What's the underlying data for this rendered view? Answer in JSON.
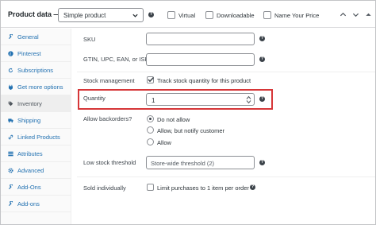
{
  "header": {
    "title": "Product data —",
    "product_type": "Simple product",
    "virtual_label": "Virtual",
    "downloadable_label": "Downloadable",
    "name_your_price_label": "Name Your Price"
  },
  "sidebar": {
    "items": [
      {
        "label": "General",
        "icon": "wrench-icon"
      },
      {
        "label": "Pinterest",
        "icon": "pinterest-icon"
      },
      {
        "label": "Subscriptions",
        "icon": "refresh-icon"
      },
      {
        "label": "Get more options",
        "icon": "plugin-icon"
      },
      {
        "label": "Inventory",
        "icon": "tag-icon",
        "active": true
      },
      {
        "label": "Shipping",
        "icon": "truck-icon"
      },
      {
        "label": "Linked Products",
        "icon": "link-icon"
      },
      {
        "label": "Attributes",
        "icon": "list-icon"
      },
      {
        "label": "Advanced",
        "icon": "gear-icon"
      },
      {
        "label": "Add-Ons",
        "icon": "wrench-icon"
      },
      {
        "label": "Add-ons",
        "icon": "wrench-icon"
      }
    ]
  },
  "inventory": {
    "sku_label": "SKU",
    "sku_value": "",
    "gtin_label": "GTIN, UPC, EAN, or ISBN",
    "gtin_value": "",
    "stock_mgmt_label": "Stock management",
    "stock_mgmt_text": "Track stock quantity for this product",
    "stock_mgmt_checked": true,
    "quantity_label": "Quantity",
    "quantity_value": "1",
    "backorders_label": "Allow backorders?",
    "backorders_options": [
      "Do not allow",
      "Allow, but notify customer",
      "Allow"
    ],
    "backorders_selected": "Do not allow",
    "low_stock_label": "Low stock threshold",
    "low_stock_value": "Store-wide threshold (2)",
    "sold_individually_label": "Sold individually",
    "sold_individually_text": "Limit purchases to 1 item per order",
    "sold_individually_checked": false
  },
  "colors": {
    "link": "#2271b1",
    "highlight": "#d63638",
    "border": "#8c8f94"
  }
}
